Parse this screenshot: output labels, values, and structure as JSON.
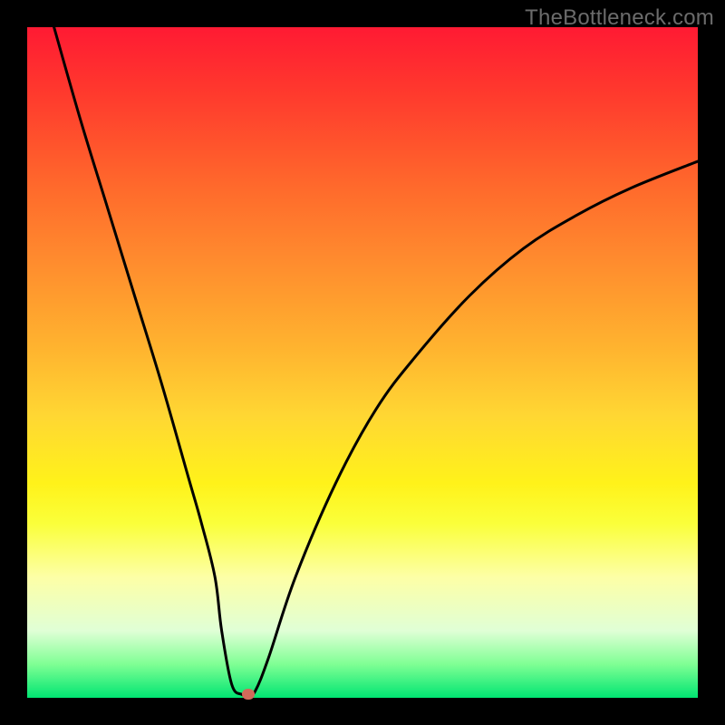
{
  "watermark": "TheBottleneck.com",
  "chart_data": {
    "type": "line",
    "title": "",
    "xlabel": "",
    "ylabel": "",
    "xlim": [
      0,
      100
    ],
    "ylim": [
      0,
      100
    ],
    "grid": false,
    "legend": false,
    "x": [
      4,
      8,
      12,
      16,
      20,
      24,
      26,
      28,
      29,
      30.5,
      32,
      33,
      34,
      36,
      40,
      46,
      52,
      58,
      66,
      74,
      82,
      90,
      100
    ],
    "y": [
      100,
      86,
      73,
      60,
      47,
      33,
      26,
      18,
      10,
      2,
      0.5,
      0.5,
      1,
      6,
      18,
      32,
      43,
      51,
      60,
      67,
      72,
      76,
      80
    ],
    "marker": {
      "x": 33,
      "y": 0.5
    },
    "curve_color": "#000000",
    "gradient_stops": [
      {
        "pos": 0,
        "color": "#ff1a33"
      },
      {
        "pos": 24,
        "color": "#ff6a2c"
      },
      {
        "pos": 48,
        "color": "#ffb42f"
      },
      {
        "pos": 68,
        "color": "#fff21a"
      },
      {
        "pos": 90,
        "color": "#e0ffd6"
      },
      {
        "pos": 100,
        "color": "#00e572"
      }
    ]
  }
}
